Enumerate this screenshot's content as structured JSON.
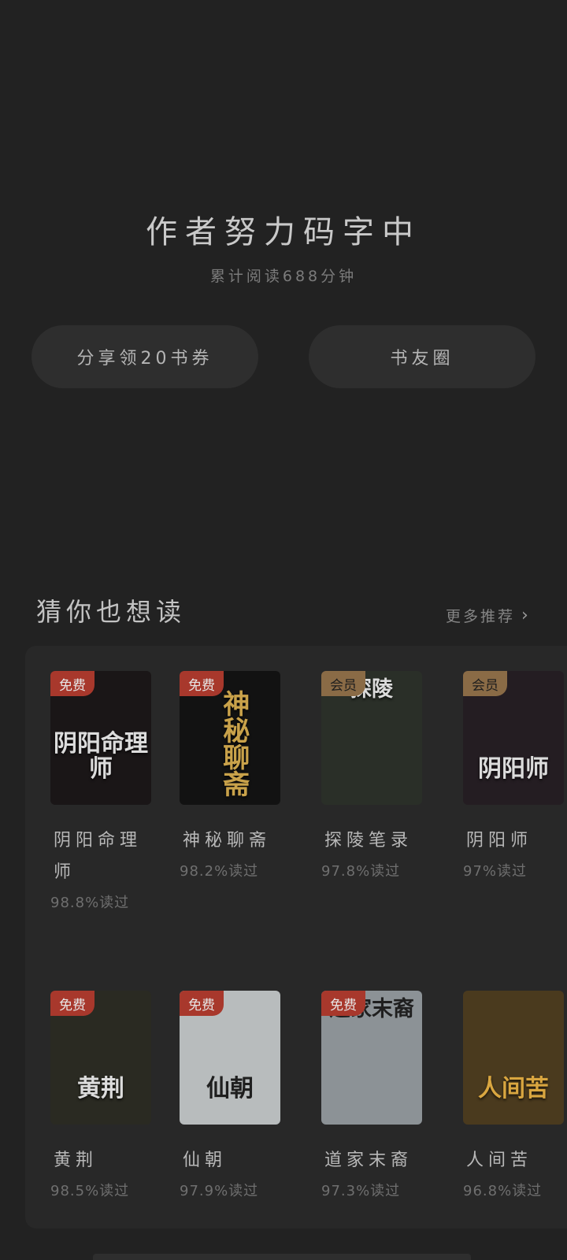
{
  "end": {
    "title": "作者努力码字中",
    "subtitle": "累计阅读688分钟",
    "share_label": "分享领20书券",
    "circle_label": "书友圈"
  },
  "recommend": {
    "title": "猜你也想读",
    "more_label": "更多推荐",
    "more_icon": "chevron-right-icon",
    "books": [
      {
        "badge": "免费",
        "badge_type": "free",
        "cover_text": "阴阳命理师",
        "name": "阴阳命理师",
        "stat": "98.8%读过",
        "cover_color": "#1a1617"
      },
      {
        "badge": "免费",
        "badge_type": "free",
        "cover_text": "神秘聊斋",
        "name": "神秘聊斋",
        "stat": "98.2%读过",
        "cover_color": "#121212"
      },
      {
        "badge": "会员",
        "badge_type": "vip",
        "cover_text": "探陵",
        "name": "探陵笔录",
        "stat": "97.8%读过",
        "cover_color": "#2a2f28"
      },
      {
        "badge": "会员",
        "badge_type": "vip",
        "cover_text": "阴阳师",
        "name": "阴阳师",
        "stat": "97%读过",
        "cover_color": "#241d22"
      },
      {
        "badge": "免费",
        "badge_type": "free",
        "cover_text": "黄荆",
        "name": "黄荆",
        "stat": "98.5%读过",
        "cover_color": "#2a2a22"
      },
      {
        "badge": "免费",
        "badge_type": "free",
        "cover_text": "仙朝",
        "name": "仙朝",
        "stat": "97.9%读过",
        "cover_color": "#b8bcbd"
      },
      {
        "badge": "免费",
        "badge_type": "free",
        "cover_text": "道家末裔",
        "name": "道家末裔",
        "stat": "97.3%读过",
        "cover_color": "#8c9296"
      },
      {
        "badge": "",
        "badge_type": "none",
        "cover_text": "人间苦",
        "name": "人间苦",
        "stat": "96.8%读过",
        "cover_color": "#4a3a1e"
      }
    ]
  }
}
